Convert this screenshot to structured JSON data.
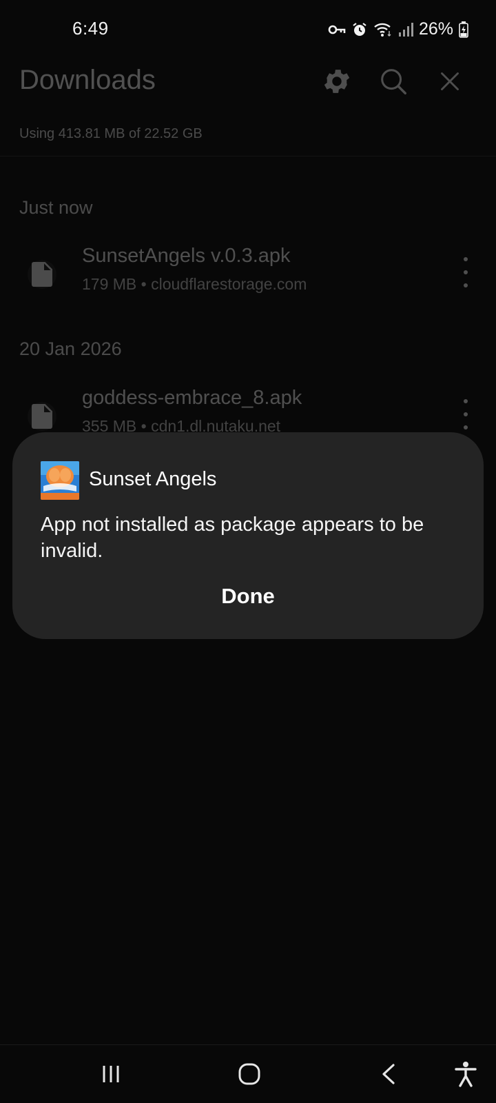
{
  "status_bar": {
    "time": "6:49",
    "battery": "26%",
    "icons": [
      "vpn-key-icon",
      "alarm-icon",
      "wifi-icon",
      "signal-icon",
      "battery-charging-icon"
    ]
  },
  "downloads": {
    "title": "Downloads",
    "header_icons": [
      "settings-icon",
      "search-icon",
      "close-icon"
    ],
    "storage": "Using 413.81 MB of 22.52 GB",
    "sections": [
      {
        "label": "Just now",
        "items": [
          {
            "name": "SunsetAngels v.0.3.apk",
            "meta": "179 MB • cloudflarestorage.com"
          }
        ]
      },
      {
        "label": "20 Jan 2026",
        "items": [
          {
            "name": "goddess-embrace_8.apk",
            "meta": "355 MB • cdn1.dl.nutaku.net"
          }
        ]
      }
    ]
  },
  "dialog": {
    "app_name": "Sunset Angels",
    "icon_text": "SUNSET ANGELS",
    "message": "App not installed as package appears to be invalid.",
    "done_label": "Done"
  },
  "nav_bar": {
    "buttons": [
      "recents-icon",
      "home-icon",
      "back-icon",
      "accessibility-icon"
    ]
  },
  "colors": {
    "background": "#080808",
    "dialog": "#242424",
    "text": "#ffffff"
  }
}
